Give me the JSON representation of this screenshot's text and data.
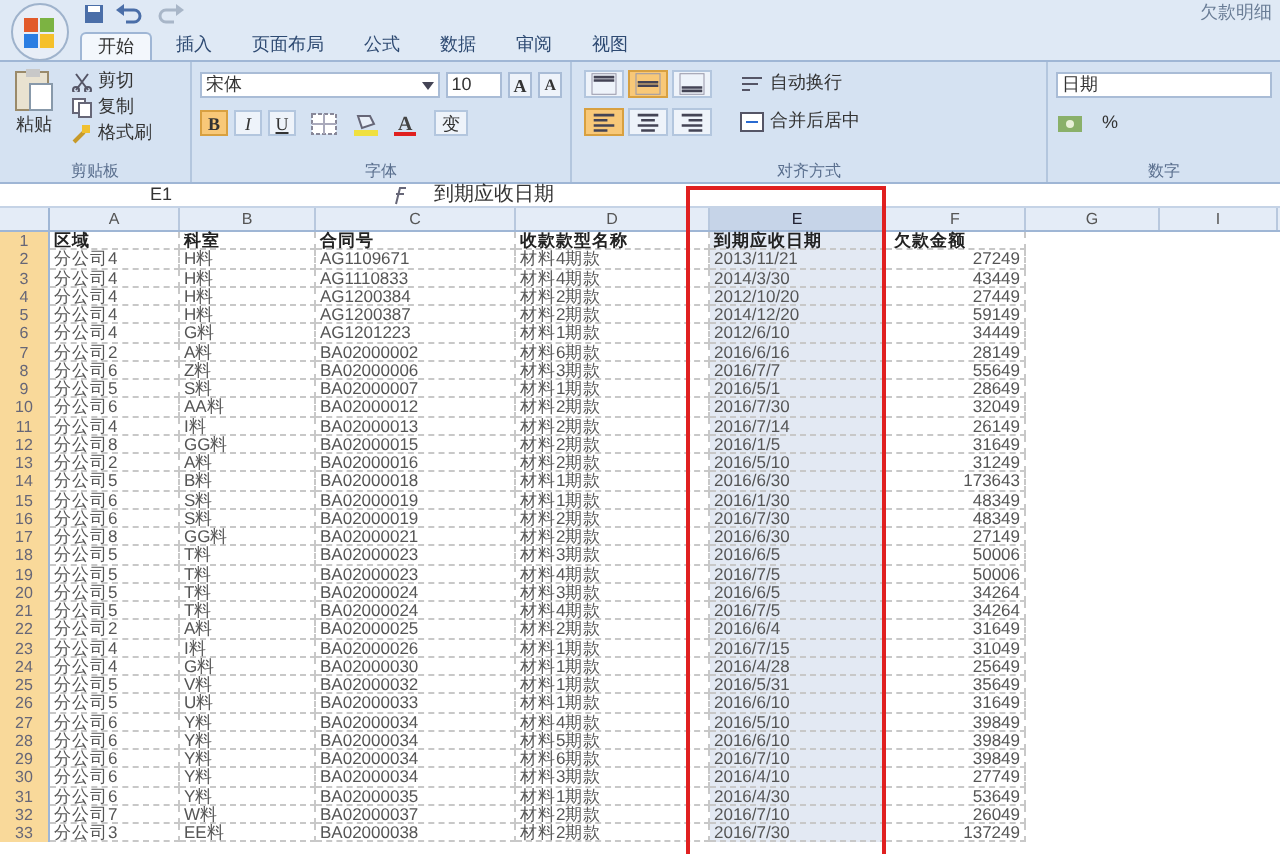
{
  "window": {
    "title": "欠款明细"
  },
  "tabs": [
    {
      "label": "开始",
      "selected": true
    },
    {
      "label": "插入",
      "selected": false
    },
    {
      "label": "页面布局",
      "selected": false
    },
    {
      "label": "公式",
      "selected": false
    },
    {
      "label": "数据",
      "selected": false
    },
    {
      "label": "审阅",
      "selected": false
    },
    {
      "label": "视图",
      "selected": false
    }
  ],
  "ribbon": {
    "clipboard": {
      "paste": "粘贴",
      "commands": [
        "剪切",
        "复制",
        "格式刷"
      ],
      "label": "剪贴板"
    },
    "font": {
      "name": "宋体",
      "size": "10",
      "grow": "A",
      "shrink": "A",
      "styles": [
        {
          "label": "B",
          "selected": true
        },
        {
          "label": "I",
          "selected": false
        },
        {
          "label": "U",
          "selected": false
        }
      ],
      "font_color": "A",
      "phonetic": "变",
      "label": "字体"
    },
    "alignment": {
      "vertical": [
        {
          "selected": false
        },
        {
          "selected": true
        },
        {
          "selected": false
        }
      ],
      "horizontal": [
        {
          "selected": true
        },
        {
          "selected": false
        },
        {
          "selected": false
        }
      ],
      "wrap": "自动换行",
      "merge": "合并后居中",
      "label": "对齐方式"
    },
    "number": {
      "format": "日期",
      "percent": "%",
      "label": "数字"
    }
  },
  "formula_bar": {
    "cell": "E1",
    "formula": "到期应收日期"
  },
  "sheet": {
    "columns": [
      {
        "label": "A",
        "selected": false
      },
      {
        "label": "B",
        "selected": false
      },
      {
        "label": "C",
        "selected": false
      },
      {
        "label": "D",
        "selected": false
      },
      {
        "label": "E",
        "selected": true
      },
      {
        "label": "F",
        "selected": false
      },
      {
        "label": "G",
        "selected": false
      },
      {
        "label": "I",
        "selected": false
      }
    ],
    "rows": [
      {
        "number": "1",
        "cells": [
          "区域",
          "科室",
          "合同号",
          "收款款型名称",
          "到期应收日期",
          "欠款金额"
        ]
      },
      {
        "number": "2",
        "cells": [
          "分公司4",
          "H料",
          "AG1109671",
          "材料4期款",
          "2013/11/21",
          "27249"
        ]
      },
      {
        "number": "3",
        "cells": [
          "分公司4",
          "H料",
          "AG1110833",
          "材料4期款",
          "2014/3/30",
          "43449"
        ]
      },
      {
        "number": "4",
        "cells": [
          "分公司4",
          "H料",
          "AG1200384",
          "材料2期款",
          "2012/10/20",
          "27449"
        ]
      },
      {
        "number": "5",
        "cells": [
          "分公司4",
          "H料",
          "AG1200387",
          "材料2期款",
          "2014/12/20",
          "59149"
        ]
      },
      {
        "number": "6",
        "cells": [
          "分公司4",
          "G料",
          "AG1201223",
          "材料1期款",
          "2012/6/10",
          "34449"
        ]
      },
      {
        "number": "7",
        "cells": [
          "分公司2",
          "A料",
          "BA02000002",
          "材料6期款",
          "2016/6/16",
          "28149"
        ]
      },
      {
        "number": "8",
        "cells": [
          "分公司6",
          "Z料",
          "BA02000006",
          "材料3期款",
          "2016/7/7",
          "55649"
        ]
      },
      {
        "number": "9",
        "cells": [
          "分公司5",
          "S料",
          "BA02000007",
          "材料1期款",
          "2016/5/1",
          "28649"
        ]
      },
      {
        "number": "10",
        "cells": [
          "分公司6",
          "AA料",
          "BA02000012",
          "材料2期款",
          "2016/7/30",
          "32049"
        ]
      },
      {
        "number": "11",
        "cells": [
          "分公司4",
          "I料",
          "BA02000013",
          "材料2期款",
          "2016/7/14",
          "26149"
        ]
      },
      {
        "number": "12",
        "cells": [
          "分公司8",
          "GG料",
          "BA02000015",
          "材料2期款",
          "2016/1/5",
          "31649"
        ]
      },
      {
        "number": "13",
        "cells": [
          "分公司2",
          "A料",
          "BA02000016",
          "材料2期款",
          "2016/5/10",
          "31249"
        ]
      },
      {
        "number": "14",
        "cells": [
          "分公司5",
          "B料",
          "BA02000018",
          "材料1期款",
          "2016/6/30",
          "173643"
        ]
      },
      {
        "number": "15",
        "cells": [
          "分公司6",
          "S料",
          "BA02000019",
          "材料1期款",
          "2016/1/30",
          "48349"
        ]
      },
      {
        "number": "16",
        "cells": [
          "分公司6",
          "S料",
          "BA02000019",
          "材料2期款",
          "2016/7/30",
          "48349"
        ]
      },
      {
        "number": "17",
        "cells": [
          "分公司8",
          "GG料",
          "BA02000021",
          "材料2期款",
          "2016/6/30",
          "27149"
        ]
      },
      {
        "number": "18",
        "cells": [
          "分公司5",
          "T料",
          "BA02000023",
          "材料3期款",
          "2016/6/5",
          "50006"
        ]
      },
      {
        "number": "19",
        "cells": [
          "分公司5",
          "T料",
          "BA02000023",
          "材料4期款",
          "2016/7/5",
          "50006"
        ]
      },
      {
        "number": "20",
        "cells": [
          "分公司5",
          "T料",
          "BA02000024",
          "材料3期款",
          "2016/6/5",
          "34264"
        ]
      },
      {
        "number": "21",
        "cells": [
          "分公司5",
          "T料",
          "BA02000024",
          "材料4期款",
          "2016/7/5",
          "34264"
        ]
      },
      {
        "number": "22",
        "cells": [
          "分公司2",
          "A料",
          "BA02000025",
          "材料2期款",
          "2016/6/4",
          "31649"
        ]
      },
      {
        "number": "23",
        "cells": [
          "分公司4",
          "I料",
          "BA02000026",
          "材料1期款",
          "2016/7/15",
          "31049"
        ]
      },
      {
        "number": "24",
        "cells": [
          "分公司4",
          "G料",
          "BA02000030",
          "材料1期款",
          "2016/4/28",
          "25649"
        ]
      },
      {
        "number": "25",
        "cells": [
          "分公司5",
          "V料",
          "BA02000032",
          "材料1期款",
          "2016/5/31",
          "35649"
        ]
      },
      {
        "number": "26",
        "cells": [
          "分公司5",
          "U料",
          "BA02000033",
          "材料1期款",
          "2016/6/10",
          "31649"
        ]
      },
      {
        "number": "27",
        "cells": [
          "分公司6",
          "Y料",
          "BA02000034",
          "材料4期款",
          "2016/5/10",
          "39849"
        ]
      },
      {
        "number": "28",
        "cells": [
          "分公司6",
          "Y料",
          "BA02000034",
          "材料5期款",
          "2016/6/10",
          "39849"
        ]
      },
      {
        "number": "29",
        "cells": [
          "分公司6",
          "Y料",
          "BA02000034",
          "材料6期款",
          "2016/7/10",
          "39849"
        ]
      },
      {
        "number": "30",
        "cells": [
          "分公司6",
          "Y料",
          "BA02000034",
          "材料3期款",
          "2016/4/10",
          "27749"
        ]
      },
      {
        "number": "31",
        "cells": [
          "分公司6",
          "Y料",
          "BA02000035",
          "材料1期款",
          "2016/4/30",
          "53649"
        ]
      },
      {
        "number": "32",
        "cells": [
          "分公司7",
          "W料",
          "BA02000037",
          "材料2期款",
          "2016/7/10",
          "26049"
        ]
      },
      {
        "number": "33",
        "cells": [
          "分公司3",
          "EE料",
          "BA02000038",
          "材料2期款",
          "2016/7/30",
          "137249"
        ]
      }
    ]
  }
}
